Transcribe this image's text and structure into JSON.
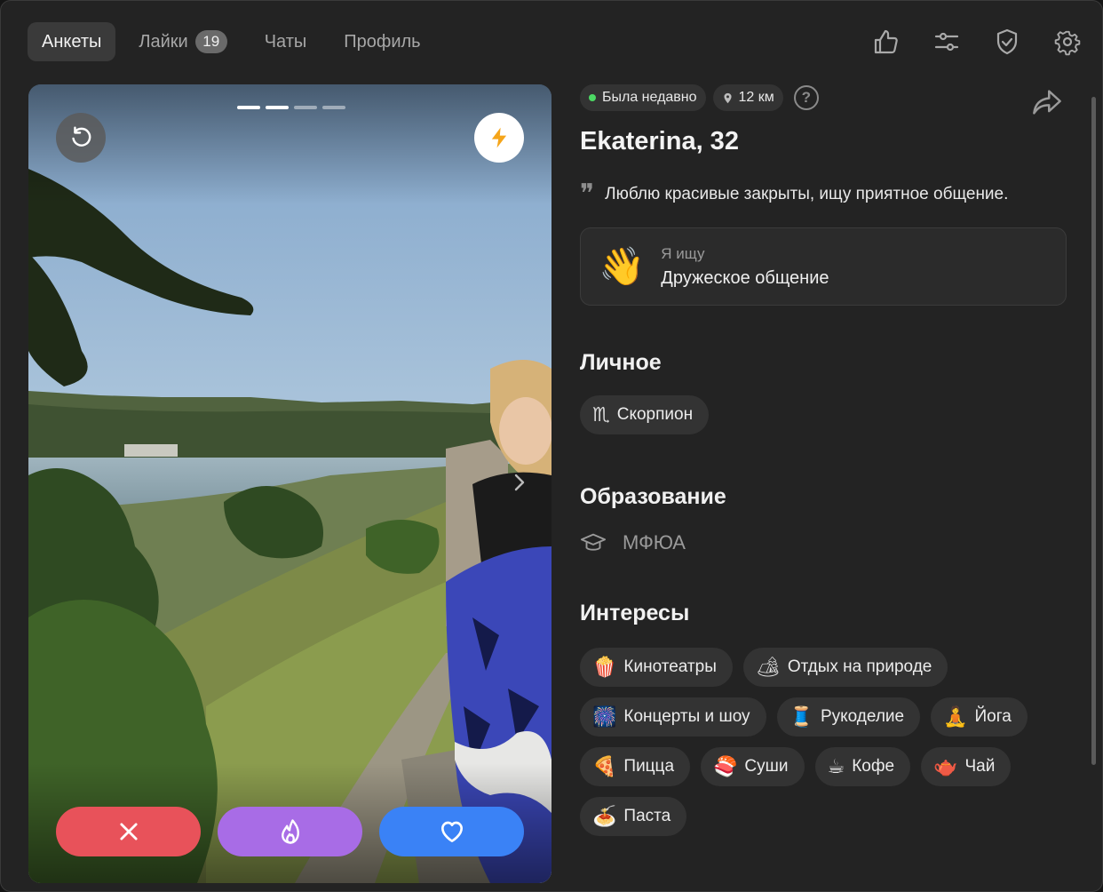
{
  "nav": {
    "tabs": [
      {
        "label": "Анкеты",
        "active": true
      },
      {
        "label": "Лайки",
        "badge": "19"
      },
      {
        "label": "Чаты"
      },
      {
        "label": "Профиль"
      }
    ],
    "icons": [
      "thumbs-up-icon",
      "sliders-icon",
      "shield-check-icon",
      "gear-icon"
    ]
  },
  "card": {
    "photos_total": 4,
    "photo_current": 2,
    "actions": [
      "close-icon",
      "fire-icon",
      "heart-icon"
    ],
    "colors": {
      "dislike": "#e8525a",
      "superlike": "#a86ce6",
      "like": "#3a82f6"
    }
  },
  "profile": {
    "status": "Была недавно",
    "distance": "12 км",
    "name": "Ekaterina, 32",
    "bio": "Люблю красивые закрыты, ищу приятное общение.",
    "looking_for": {
      "label": "Я ищу",
      "value": "Дружеское общение",
      "emoji": "👋"
    }
  },
  "personal": {
    "title": "Личное",
    "zodiac": {
      "icon": "♏",
      "label": "Скорпион"
    }
  },
  "education": {
    "title": "Образование",
    "value": "МФЮА"
  },
  "interests": {
    "title": "Интересы",
    "items": [
      {
        "emoji": "🍿",
        "label": "Кинотеатры"
      },
      {
        "emoji": "🏕",
        "label": "Отдых на природе"
      },
      {
        "emoji": "🎆",
        "label": "Концерты и шоу"
      },
      {
        "emoji": "🧵",
        "label": "Рукоделие"
      },
      {
        "emoji": "🧘",
        "label": "Йога"
      },
      {
        "emoji": "🍕",
        "label": "Пицца"
      },
      {
        "emoji": "🍣",
        "label": "Суши"
      },
      {
        "emoji": "☕",
        "label": "Кофе"
      },
      {
        "emoji": "🫖",
        "label": "Чай"
      },
      {
        "emoji": "🍝",
        "label": "Паста"
      }
    ]
  }
}
